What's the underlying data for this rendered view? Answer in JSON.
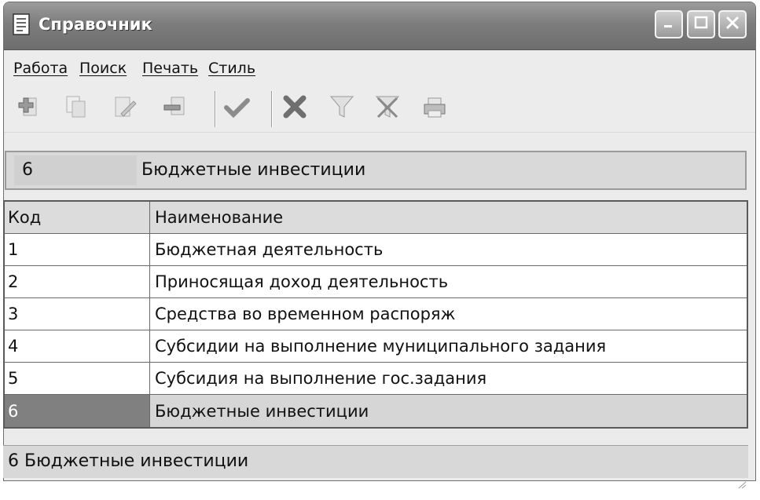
{
  "window": {
    "title": "Справочник",
    "icon": "document-list-icon",
    "controls": [
      "minimize-icon",
      "maximize-icon",
      "close-icon"
    ]
  },
  "menu": {
    "items": [
      {
        "label": "Работа"
      },
      {
        "label": "Поиск"
      },
      {
        "label": "Печать"
      },
      {
        "label": "Стиль"
      }
    ]
  },
  "toolbar": {
    "buttons": [
      {
        "icon": "add-record-icon",
        "enabled": false
      },
      {
        "icon": "copy-record-icon",
        "enabled": false
      },
      {
        "icon": "edit-record-icon",
        "enabled": false
      },
      {
        "icon": "delete-record-icon",
        "enabled": false
      },
      {
        "icon": "confirm-check-icon",
        "enabled": false
      },
      {
        "icon": "cancel-x-icon",
        "enabled": false
      },
      {
        "icon": "filter-icon",
        "enabled": false
      },
      {
        "icon": "clear-filter-icon",
        "enabled": false
      },
      {
        "icon": "print-icon",
        "enabled": false
      }
    ]
  },
  "current": {
    "code": "6",
    "name": "Бюджетные инвестиции"
  },
  "table": {
    "columns": [
      "Код",
      "Наименование"
    ],
    "rows": [
      {
        "code": "1",
        "name": "Бюджетная деятельность"
      },
      {
        "code": "2",
        "name": "Приносящая доход деятельность"
      },
      {
        "code": "3",
        "name": "Средства во временном распоряж"
      },
      {
        "code": "4",
        "name": "Субсидии на выполнение муниципального задания"
      },
      {
        "code": "5",
        "name": "Субсидия на выполнение гос.задания"
      },
      {
        "code": "6",
        "name": "Бюджетные инвестиции"
      }
    ],
    "selected_code": "6"
  },
  "status": {
    "text": "6 Бюджетные инвестиции"
  }
}
